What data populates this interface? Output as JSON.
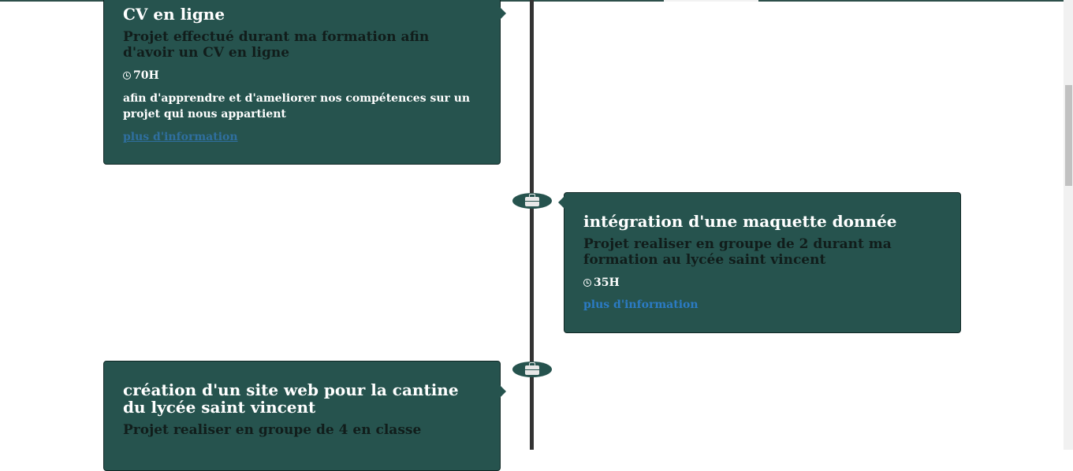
{
  "timeline": {
    "items": [
      {
        "title": "CV en ligne",
        "subtitle": "Projet effectué durant ma formation afin d'avoir un CV en ligne",
        "duration": "70H",
        "description": "afin d'apprendre et d'ameliorer nos compétences sur un projet qui nous appartient",
        "link": "plus d'information"
      },
      {
        "title": "intégration d'une maquette donnée",
        "subtitle": "Projet realiser en groupe de 2 durant ma formation au lycée saint vincent",
        "duration": "35H",
        "link": "plus d'information"
      },
      {
        "title": "création d'un site web pour la cantine du lycée saint vincent",
        "subtitle": "Projet realiser en groupe de 4 en classe"
      }
    ]
  },
  "icons": {
    "duration": "clock-icon",
    "marker": "briefcase-icon"
  },
  "colors": {
    "card_background": "#26534e",
    "timeline_line": "#333333",
    "link": "#2b7bc4",
    "subtitle_text": "#111d1b"
  }
}
